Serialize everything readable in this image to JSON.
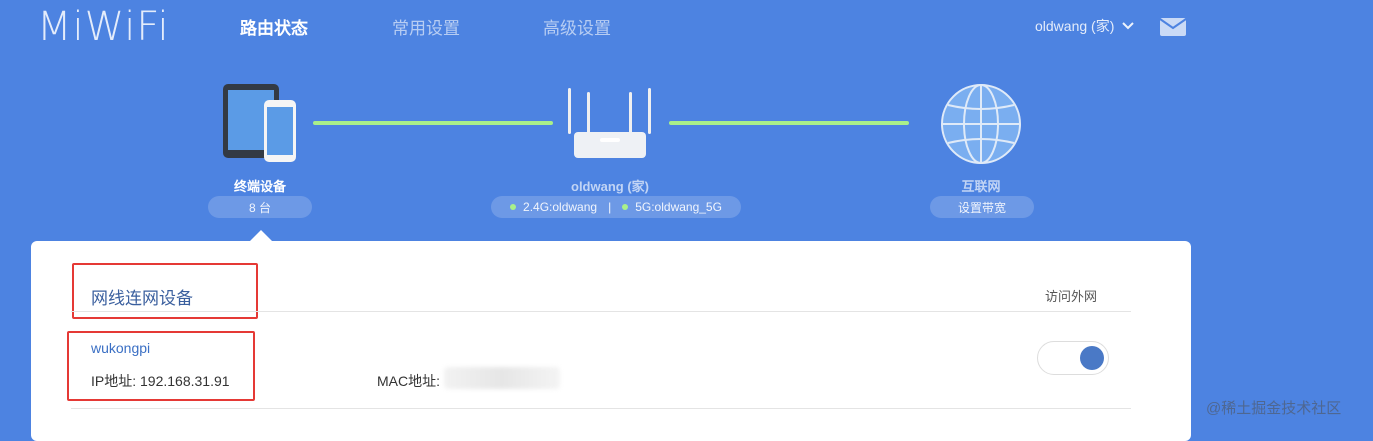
{
  "header": {
    "logo": "MiWiFi",
    "tabs": [
      {
        "label": "路由状态",
        "active": true
      },
      {
        "label": "常用设置",
        "active": false
      },
      {
        "label": "高级设置",
        "active": false
      }
    ],
    "user": "oldwang (家)",
    "icons": {
      "user_menu": "chevron-down-icon",
      "mail": "mail-icon"
    }
  },
  "topology": {
    "devices": {
      "label": "终端设备",
      "count": "8 台"
    },
    "router": {
      "label": "oldwang (家)",
      "wifi_24": "2.4G:oldwang",
      "separator": "|",
      "wifi_5": "5G:oldwang_5G"
    },
    "internet": {
      "label": "互联网",
      "action": "设置带宽"
    }
  },
  "card": {
    "section_title": "网线连网设备",
    "access_header": "访问外网",
    "device": {
      "name": "wukongpi",
      "ip": "IP地址: 192.168.31.91",
      "mac": "MAC地址: "
    },
    "internet_access_enabled": true
  },
  "watermark": "@稀土掘金技术社区",
  "colors": {
    "background": "#4d83e1",
    "link": "#a9f08a",
    "accent": "#4a79c6",
    "annotation": "#e53935"
  }
}
